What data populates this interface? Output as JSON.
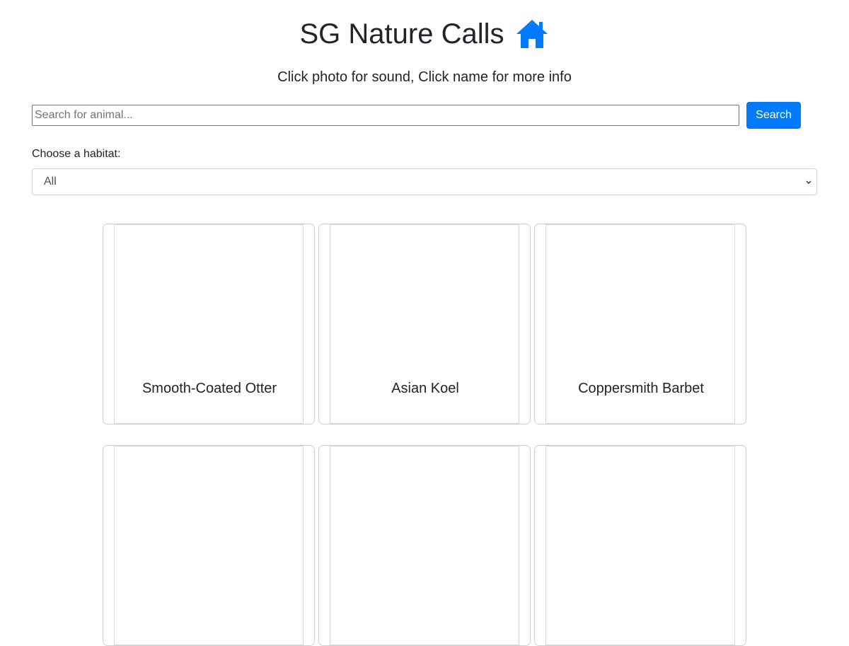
{
  "header": {
    "title": "SG Nature Calls",
    "home_icon": "home-icon",
    "subtitle": "Click photo for sound, Click name for more info"
  },
  "search": {
    "placeholder": "Search for animal...",
    "value": "",
    "button_label": "Search"
  },
  "habitat": {
    "label": "Choose a habitat:",
    "selected": "All"
  },
  "colors": {
    "accent": "#007bff",
    "text": "#212529"
  },
  "animals": [
    {
      "name": "Smooth-Coated Otter"
    },
    {
      "name": "Asian Koel"
    },
    {
      "name": "Coppersmith Barbet"
    },
    {
      "name": ""
    },
    {
      "name": ""
    },
    {
      "name": ""
    }
  ]
}
